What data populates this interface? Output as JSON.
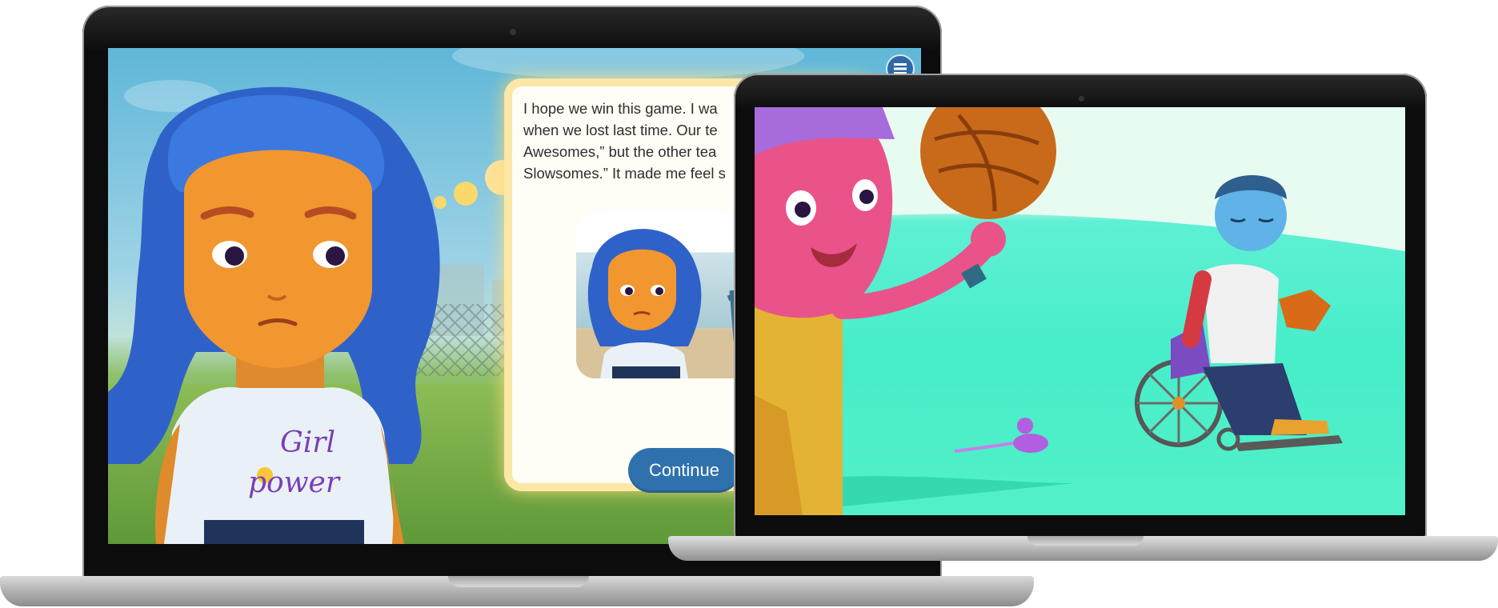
{
  "app": {
    "menu_icon": "hamburger-menu-icon"
  },
  "story_card": {
    "text": "I hope we win this game. I wa\nwhen we lost last time. Our te\nAwesomes,” but the other tea\nSlowsomes.” It made me feel s",
    "shirt_text": "Girl\npower",
    "continue_label": "Continue"
  },
  "colors": {
    "accent": "#2f71ad",
    "card_glow": "#fbe7a6",
    "sky": "#5fb7d8",
    "field": "#47eec9"
  }
}
